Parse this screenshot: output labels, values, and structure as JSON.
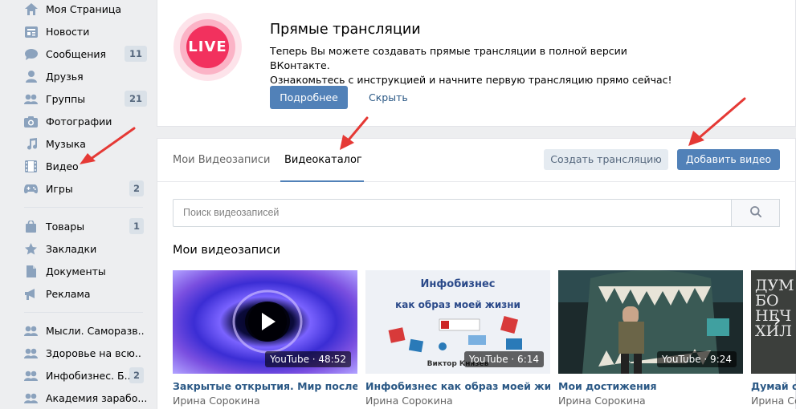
{
  "sidebar": {
    "items": [
      {
        "label": "Моя Страница",
        "icon": "home-icon"
      },
      {
        "label": "Новости",
        "icon": "news-icon"
      },
      {
        "label": "Сообщения",
        "icon": "messages-icon",
        "count": "11"
      },
      {
        "label": "Друзья",
        "icon": "friends-icon"
      },
      {
        "label": "Группы",
        "icon": "groups-icon",
        "count": "21"
      },
      {
        "label": "Фотографии",
        "icon": "camera-icon"
      },
      {
        "label": "Музыка",
        "icon": "music-icon"
      },
      {
        "label": "Видео",
        "icon": "film-icon"
      },
      {
        "label": "Игры",
        "icon": "gamepad-icon",
        "count": "2"
      },
      {
        "label": "Товары",
        "icon": "bag-icon",
        "count": "1"
      },
      {
        "label": "Закладки",
        "icon": "star-icon"
      },
      {
        "label": "Документы",
        "icon": "document-icon"
      },
      {
        "label": "Реклама",
        "icon": "megaphone-icon"
      },
      {
        "label": "Мысли. Саморазв..",
        "icon": "group-icon"
      },
      {
        "label": "Здоровье на всю..",
        "icon": "group-icon"
      },
      {
        "label": "Инфобизнес. Б...",
        "icon": "group-icon",
        "count": "2"
      },
      {
        "label": "Академия зарабо...",
        "icon": "group-icon"
      }
    ]
  },
  "live": {
    "logo_text": "LIVE",
    "title": "Прямые трансляции",
    "text_line1": "Теперь Вы можете создавать прямые трансляции в полной версии ВКонтакте.",
    "text_line2": "Ознакомьтесь с инструкцией и начните первую трансляцию прямо сейчас!",
    "more_label": "Подробнее",
    "hide_label": "Скрыть"
  },
  "video": {
    "tabs": [
      {
        "label": "Мои Видеозаписи",
        "active": false
      },
      {
        "label": "Видеокаталог",
        "active": true
      }
    ],
    "create_stream_label": "Создать трансляцию",
    "add_video_label": "Добавить видео",
    "search_placeholder": "Поиск видеозаписей",
    "section_title": "Мои видеозаписи",
    "cards": [
      {
        "title": "Закрытые открытия. Мир после Кван",
        "author": "Ирина Сорокина",
        "duration": "YouTube · 48:52"
      },
      {
        "title": "Инфобизнес как образ моей жизни",
        "author": "Ирина Сорокина",
        "duration": "YouTube · 6:14",
        "thumb_line1": "Инфобизнес",
        "thumb_line2": "как образ моей жизни",
        "thumb_line3": "Виктор Князев"
      },
      {
        "title": "Мои достижения",
        "author": "Ирина Сорокина",
        "duration": "YouTube · 9:24"
      },
      {
        "title": "Думай о",
        "author": "Ирина Сорокина",
        "thumb_text": "ДУМ БО НЕЧ ХИЛ"
      }
    ]
  },
  "colors": {
    "accent": "#5181b8",
    "link": "#2a5885",
    "live_red": "#f2315e",
    "arrow_red": "#e53935"
  }
}
